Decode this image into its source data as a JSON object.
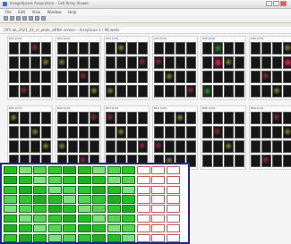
{
  "window": {
    "title": "ImageXpress Acquisition – Cell Array Viewer"
  },
  "menu": [
    "File",
    "Edit",
    "View",
    "Window",
    "Help"
  ],
  "path": "[XP] ab_2021_01_ct_plate_siRNA screen – ArrayScan 1 / 96 wells",
  "panels": [
    {
      "label": "A01 [1/3]"
    },
    {
      "label": "A02 [1/3]"
    },
    {
      "label": "A03 [1/3]"
    },
    {
      "label": "A04 [1/3]"
    },
    {
      "label": "A05 [1/3]"
    },
    {
      "label": "A06 [1/3]"
    },
    {
      "label": "B01 [1/3]"
    },
    {
      "label": "B02 [1/3]"
    },
    {
      "label": "B03 [1/3]"
    },
    {
      "label": "B04 [1/3]"
    },
    {
      "label": "B05 [1/3]"
    },
    {
      "label": "B06 [1/3]"
    }
  ],
  "plate": {
    "rows": 8,
    "cols": 12,
    "filled_color": "#33cc33",
    "empty_border": "#c25a5a",
    "outline": "#1e2a7a"
  }
}
